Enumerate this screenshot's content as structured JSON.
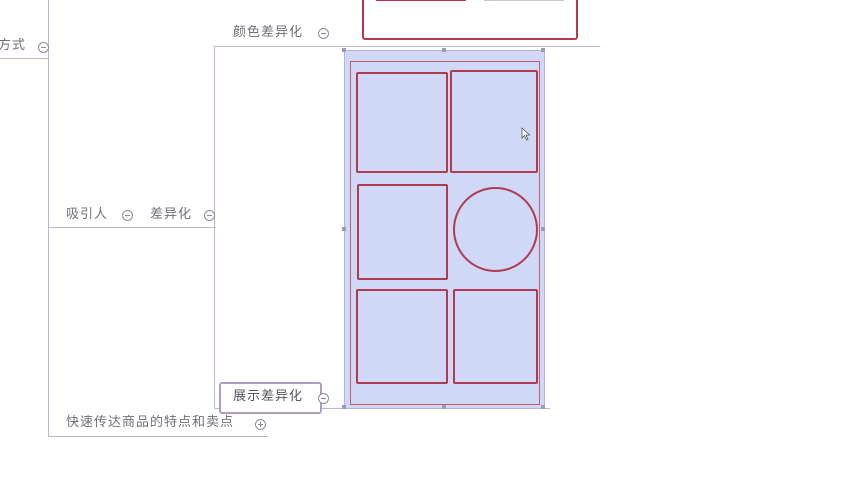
{
  "mindmap": {
    "nodes": {
      "fangshi": "方式",
      "color_diff": "颜色差异化",
      "attract": "吸引人",
      "diff": "差异化",
      "display_diff": "展示差异化",
      "convey": "快速传达商品的特点和卖点"
    }
  },
  "canvas": {
    "background": "#ffffff",
    "line_color": "#b9b7d6",
    "image_fill": "#cfd8f6",
    "image_stroke": "#b23a50",
    "selection_border": "#b39cc4"
  }
}
